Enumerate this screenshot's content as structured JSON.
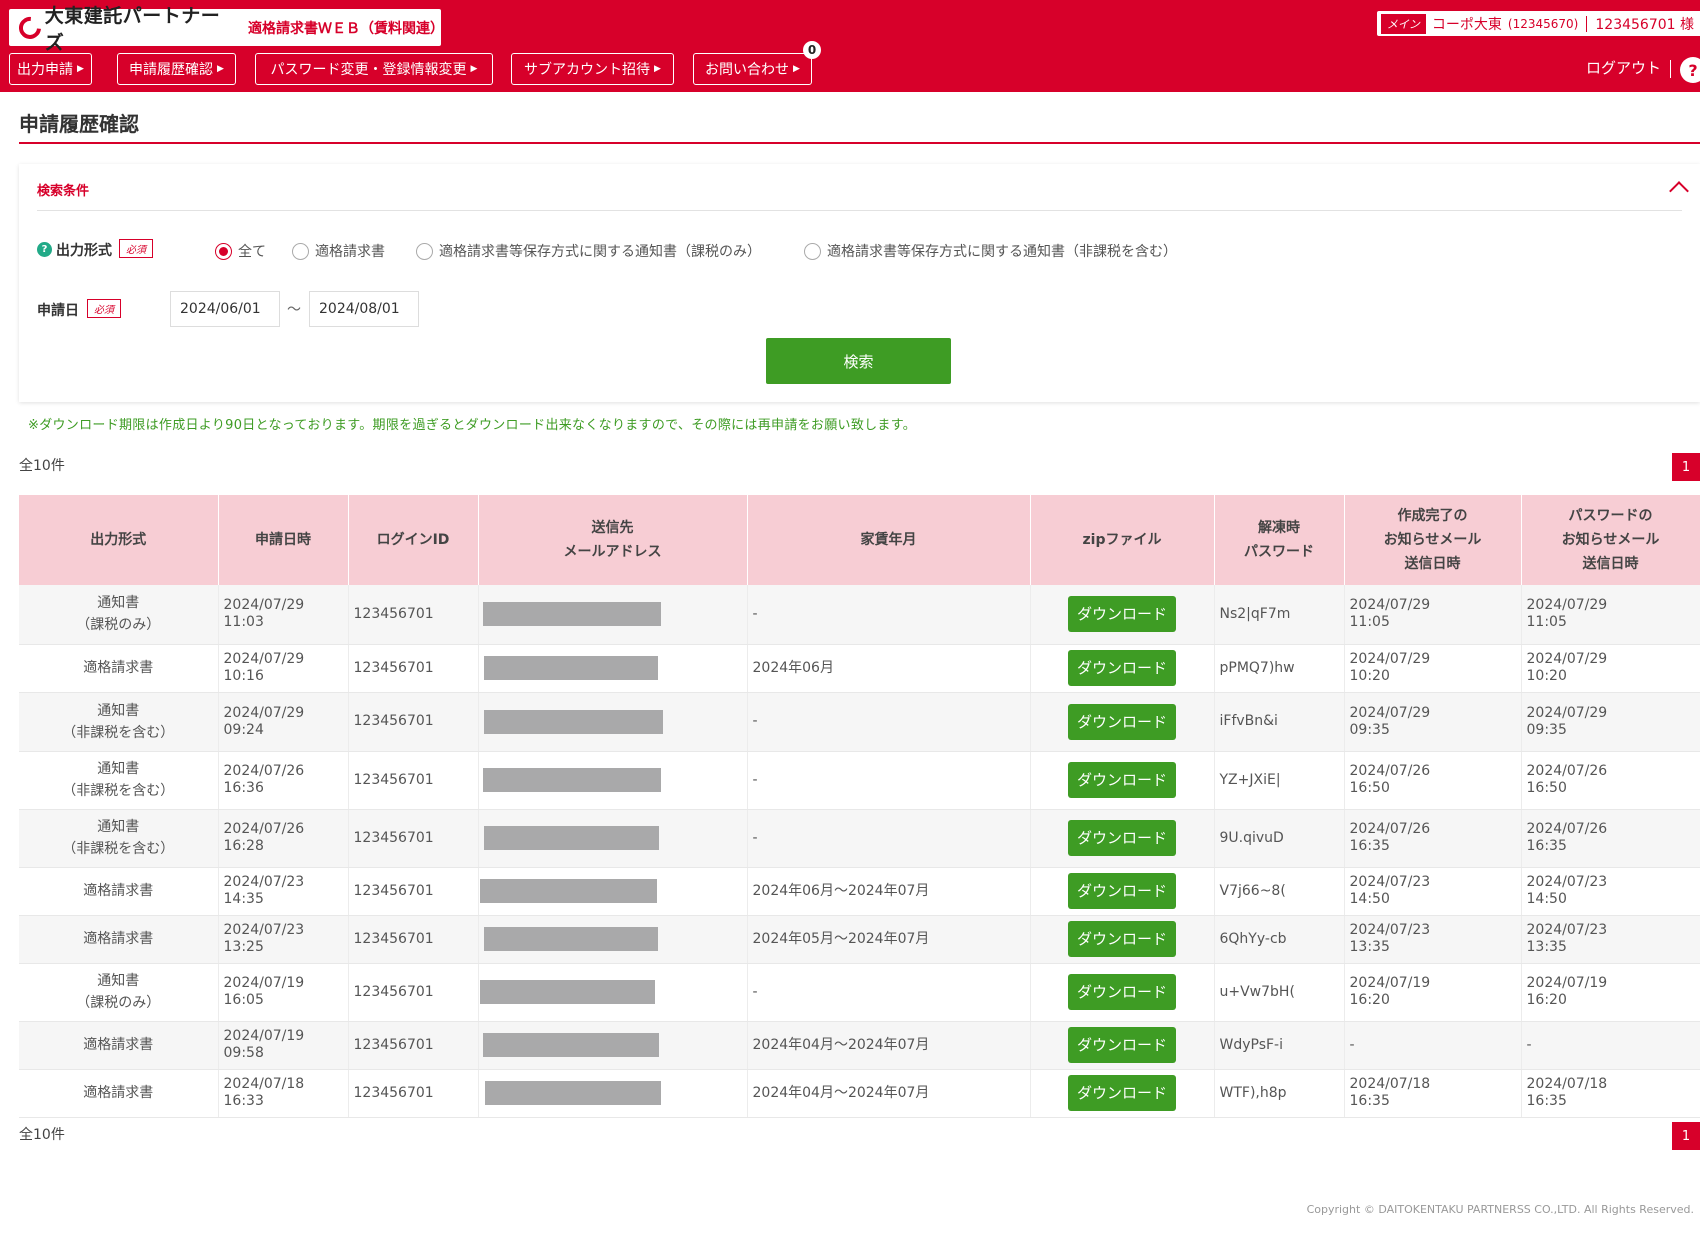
{
  "header": {
    "brand": "大東建託パートナーズ",
    "subtitle": "適格請求書ＷＥＢ（賃料関連）",
    "account_tag": "メイン",
    "account_name": "コーポ大東",
    "account_code": "(12345670)",
    "account_id": "123456701 様",
    "notification_count": "0",
    "logout": "ログアウト",
    "help": "?"
  },
  "nav": [
    {
      "label": "出力申請"
    },
    {
      "label": "申請履歴確認"
    },
    {
      "label": "パスワード変更・登録情報変更"
    },
    {
      "label": "サブアカウント招待"
    },
    {
      "label": "お問い合わせ"
    }
  ],
  "page_title": "申請履歴確認",
  "search": {
    "heading": "検索条件",
    "output_label": "出力形式",
    "required": "必須",
    "options": [
      "全て",
      "適格請求書",
      "適格請求書等保存方式に関する通知書（課税のみ）",
      "適格請求書等保存方式に関する通知書（非課税を含む）"
    ],
    "selected_option": "全て",
    "date_label": "申請日",
    "date_from": "2024/06/01",
    "date_to": "2024/08/01",
    "tilde": "〜",
    "button": "検索"
  },
  "note": "※ダウンロード期限は作成日より90日となっております。期限を過ぎるとダウンロード出来なくなりますので、その際には再申請をお願い致します。",
  "total_label": "全10件",
  "page_number": "1",
  "table": {
    "headers": [
      "出力形式",
      "申請日時",
      "ログインID",
      "送信先\nメールアドレス",
      "家賃年月",
      "zipファイル",
      "解凍時\nパスワード",
      "作成完了の\nお知らせメール\n送信日時",
      "パスワードの\nお知らせメール\n送信日時"
    ],
    "download_label": "ダウンロード",
    "rows": [
      {
        "type": [
          "通知書",
          "（課税のみ）"
        ],
        "applied": [
          "2024/07/29",
          "11:03"
        ],
        "login": "123456701",
        "rent": "-",
        "password": "Ns2|qF7m",
        "created": [
          "2024/07/29",
          "11:05"
        ],
        "pw_sent": [
          "2024/07/29",
          "11:05"
        ]
      },
      {
        "type": [
          "適格請求書"
        ],
        "applied": [
          "2024/07/29",
          "10:16"
        ],
        "login": "123456701",
        "rent": "2024年06月",
        "password": "pPMQ7)hw",
        "created": [
          "2024/07/29",
          "10:20"
        ],
        "pw_sent": [
          "2024/07/29",
          "10:20"
        ]
      },
      {
        "type": [
          "通知書",
          "（非課税を含む）"
        ],
        "applied": [
          "2024/07/29",
          "09:24"
        ],
        "login": "123456701",
        "rent": "-",
        "password": "iFfvBn&i",
        "created": [
          "2024/07/29",
          "09:35"
        ],
        "pw_sent": [
          "2024/07/29",
          "09:35"
        ]
      },
      {
        "type": [
          "通知書",
          "（非課税を含む）"
        ],
        "applied": [
          "2024/07/26",
          "16:36"
        ],
        "login": "123456701",
        "rent": "-",
        "password": "YZ+JXiE|",
        "created": [
          "2024/07/26",
          "16:50"
        ],
        "pw_sent": [
          "2024/07/26",
          "16:50"
        ]
      },
      {
        "type": [
          "通知書",
          "（非課税を含む）"
        ],
        "applied": [
          "2024/07/26",
          "16:28"
        ],
        "login": "123456701",
        "rent": "-",
        "password": "9U.qivuD",
        "created": [
          "2024/07/26",
          "16:35"
        ],
        "pw_sent": [
          "2024/07/26",
          "16:35"
        ]
      },
      {
        "type": [
          "適格請求書"
        ],
        "applied": [
          "2024/07/23",
          "14:35"
        ],
        "login": "123456701",
        "rent": "2024年06月～2024年07月",
        "password": "V7j66~8(",
        "created": [
          "2024/07/23",
          "14:50"
        ],
        "pw_sent": [
          "2024/07/23",
          "14:50"
        ]
      },
      {
        "type": [
          "適格請求書"
        ],
        "applied": [
          "2024/07/23",
          "13:25"
        ],
        "login": "123456701",
        "rent": "2024年05月～2024年07月",
        "password": "6QhYy-cb",
        "created": [
          "2024/07/23",
          "13:35"
        ],
        "pw_sent": [
          "2024/07/23",
          "13:35"
        ]
      },
      {
        "type": [
          "通知書",
          "（課税のみ）"
        ],
        "applied": [
          "2024/07/19",
          "16:05"
        ],
        "login": "123456701",
        "rent": "-",
        "password": "u+Vw7bH(",
        "created": [
          "2024/07/19",
          "16:20"
        ],
        "pw_sent": [
          "2024/07/19",
          "16:20"
        ]
      },
      {
        "type": [
          "適格請求書"
        ],
        "applied": [
          "2024/07/19",
          "09:58"
        ],
        "login": "123456701",
        "rent": "2024年04月～2024年07月",
        "password": "WdyPsF-i",
        "created": [
          "-"
        ],
        "pw_sent": [
          "-"
        ]
      },
      {
        "type": [
          "適格請求書"
        ],
        "applied": [
          "2024/07/18",
          "16:33"
        ],
        "login": "123456701",
        "rent": "2024年04月～2024年07月",
        "password": "WTF),h8p",
        "created": [
          "2024/07/18",
          "16:35"
        ],
        "pw_sent": [
          "2024/07/18",
          "16:35"
        ]
      }
    ]
  },
  "copyright": "Copyright © DAITOKENTAKU PARTNERSS CO.,LTD. All Rights Reserved.",
  "colors": {
    "brand_red": "#d7002a",
    "action_green": "#3e9c24",
    "table_header_pink": "#f7cdd4"
  }
}
